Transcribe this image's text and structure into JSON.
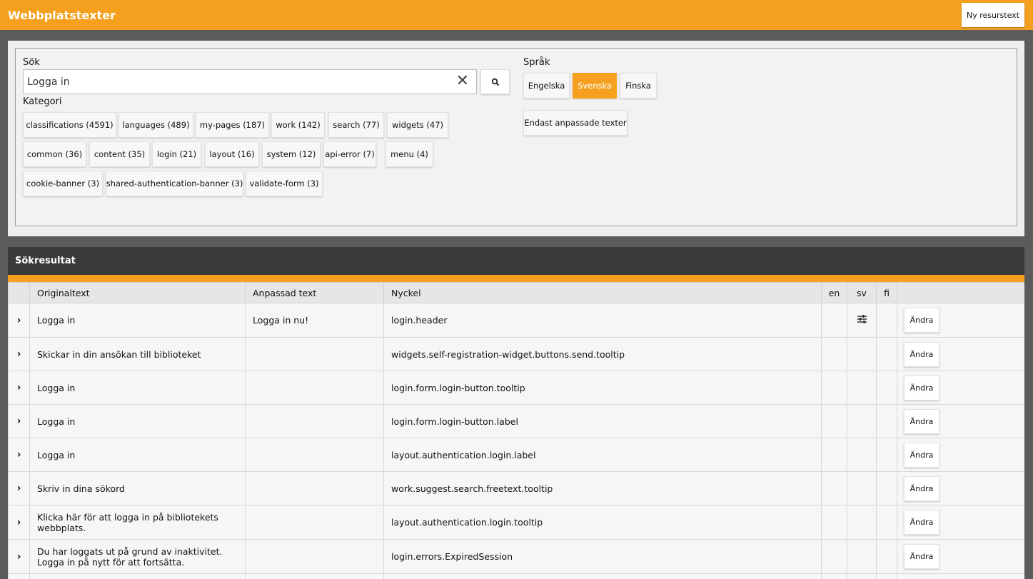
{
  "header": {
    "title": "Webbplatstexter",
    "new_button": "Ny resurstext"
  },
  "search": {
    "label": "Sök",
    "value": "Logga in",
    "category_label": "Kategori"
  },
  "categories": [
    "classifications (4591)",
    "languages (489)",
    "my-pages (187)",
    "work (142)",
    "search (77)",
    "widgets (47)",
    "common (36)",
    "content (35)",
    "login (21)",
    "layout (16)",
    "system (12)",
    "api-error (7)",
    "menu (4)",
    "cookie-banner (3)",
    "shared-authentication-banner (3)",
    "validate-form (3)"
  ],
  "language": {
    "label": "Språk",
    "options": [
      "Engelska",
      "Svenska",
      "Finska"
    ],
    "selected": "Svenska",
    "custom_only": "Endast anpassade texter"
  },
  "results": {
    "title": "Sökresultat",
    "columns": [
      "Originaltext",
      "Anpassad text",
      "Nyckel",
      "en",
      "sv",
      "fi"
    ],
    "edit_label": "Ändra",
    "rows": [
      {
        "original": "Logga in",
        "custom": "Logga in nu!",
        "key": "login.header",
        "en": "",
        "sv": "sliders-icon",
        "fi": ""
      },
      {
        "original": "Skickar in din ansökan till biblioteket",
        "custom": "",
        "key": "widgets.self-registration-widget.buttons.send.tooltip",
        "en": "",
        "sv": "",
        "fi": ""
      },
      {
        "original": "Logga in",
        "custom": "",
        "key": "login.form.login-button.tooltip",
        "en": "",
        "sv": "",
        "fi": ""
      },
      {
        "original": "Logga in",
        "custom": "",
        "key": "login.form.login-button.label",
        "en": "",
        "sv": "",
        "fi": ""
      },
      {
        "original": "Logga in",
        "custom": "",
        "key": "layout.authentication.login.label",
        "en": "",
        "sv": "",
        "fi": ""
      },
      {
        "original": "Skriv in dina sökord",
        "custom": "",
        "key": "work.suggest.search.freetext.tooltip",
        "en": "",
        "sv": "",
        "fi": ""
      },
      {
        "original": "Klicka här för att logga in på bibliotekets webbplats.",
        "custom": "",
        "key": "layout.authentication.login.tooltip",
        "en": "",
        "sv": "",
        "fi": ""
      },
      {
        "original": "Du har loggats ut på grund av inaktivitet. Logga in på nytt för att fortsätta.",
        "custom": "",
        "key": "login.errors.ExpiredSession",
        "en": "",
        "sv": "",
        "fi": ""
      },
      {
        "original": "",
        "custom": "",
        "key": "",
        "en": "",
        "sv": "",
        "fi": ""
      }
    ]
  },
  "colors": {
    "accent": "#f5a11f",
    "dark_header": "#3b3b3b",
    "background": "#5b5b5b"
  }
}
